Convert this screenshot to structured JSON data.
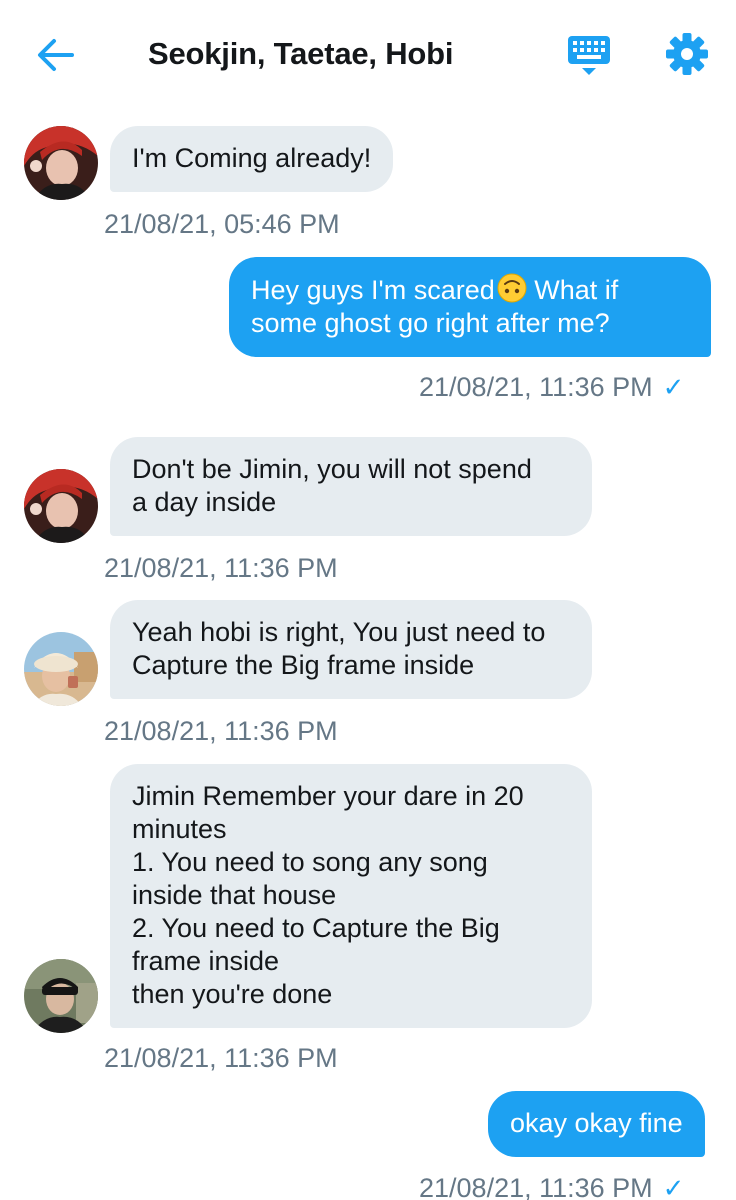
{
  "header": {
    "title": "Seokjin, Taetae, Hobi",
    "back_icon": "arrow-left-icon",
    "keyboard_icon": "keyboard-icon",
    "settings_icon": "gear-icon"
  },
  "colors": {
    "accent": "#1da1f2",
    "received_bubble": "#e6ecf0",
    "timestamp": "#657786"
  },
  "messages": [
    {
      "direction": "received",
      "sender_avatar": "avatar-red-hair",
      "text": "I'm Coming already!",
      "timestamp": "21/08/21, 05:46 PM"
    },
    {
      "direction": "sent",
      "text_before_emoji": "Hey guys I'm scared",
      "emoji": "upside-down-face-emoji",
      "text_after_emoji": " What if some ghost go right after me?",
      "timestamp": "21/08/21, 11:36 PM",
      "read_mark": "✓"
    },
    {
      "direction": "received",
      "sender_avatar": "avatar-red-hair",
      "text": "Don't be Jimin, you will not spend\na day inside",
      "timestamp": "21/08/21, 11:36 PM"
    },
    {
      "direction": "received",
      "sender_avatar": "avatar-bucket-hat",
      "text": "Yeah hobi is right, You just need to\nCapture the Big frame inside",
      "timestamp": "21/08/21, 11:36 PM"
    },
    {
      "direction": "received",
      "sender_avatar": "avatar-black-cap",
      "text": "Jimin Remember your dare in 20\nminutes\n1. You need to song any song\ninside that house\n2. You need to Capture the Big\nframe inside\n then you're done",
      "timestamp": "21/08/21, 11:36 PM"
    },
    {
      "direction": "sent",
      "text": "okay okay fine",
      "timestamp": "21/08/21, 11:36 PM",
      "read_mark": "✓"
    }
  ]
}
